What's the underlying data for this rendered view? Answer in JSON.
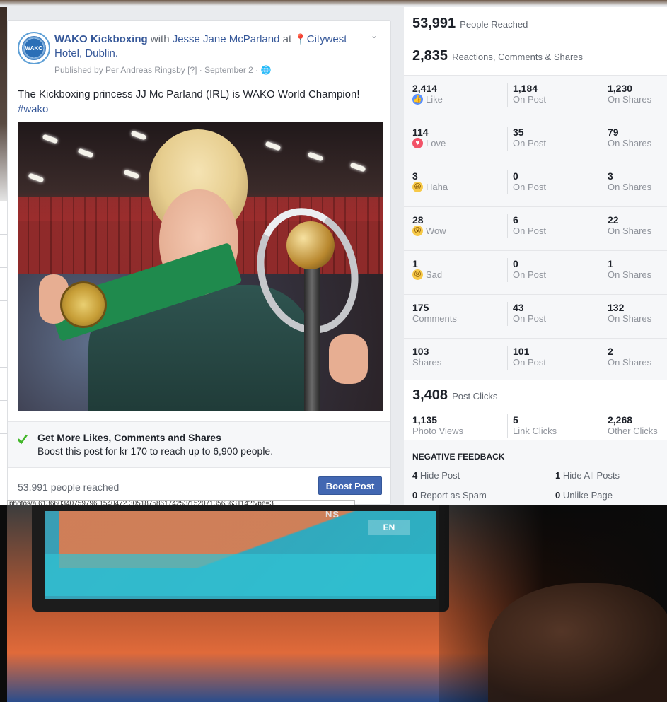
{
  "post": {
    "page_name": "WAKO Kickboxing",
    "with_word": " with ",
    "tagged_person": "Jesse Jane McParland",
    "at_word": " at ",
    "location": "Citywest Hotel, Dublin.",
    "published_by": "Published by Per Andreas Ringsby [?] · September 2 · ",
    "avatar_text": "WAKO",
    "body_text": "The Kickboxing princess JJ Mc Parland (IRL) is WAKO World Champion!",
    "hashtag": "#wako",
    "boost_title": "Get More Likes, Comments and Shares",
    "boost_subtitle": "Boost this post for kr 170 to reach up to 6,900 people.",
    "people_reached_line": "53,991 people reached",
    "boost_button": "Boost Post",
    "tooltip_url": "photos/a.613660340759796.1540472.305187586174253/152071356363114?type=3"
  },
  "stats": {
    "reached_num": "53,991",
    "reached_label": "People Reached",
    "rcs_num": "2,835",
    "rcs_label": "Reactions, Comments & Shares",
    "rows": [
      {
        "total": "2,414",
        "label": "Like",
        "icon": "like-icon",
        "on_post": "1,184",
        "on_shares": "1,230"
      },
      {
        "total": "114",
        "label": "Love",
        "icon": "love-icon",
        "on_post": "35",
        "on_shares": "79"
      },
      {
        "total": "3",
        "label": "Haha",
        "icon": "haha-icon",
        "on_post": "0",
        "on_shares": "3"
      },
      {
        "total": "28",
        "label": "Wow",
        "icon": "wow-icon",
        "on_post": "6",
        "on_shares": "22"
      },
      {
        "total": "1",
        "label": "Sad",
        "icon": "sad-icon",
        "on_post": "0",
        "on_shares": "1"
      },
      {
        "total": "175",
        "label": "Comments",
        "icon": "",
        "on_post": "43",
        "on_shares": "132"
      },
      {
        "total": "103",
        "label": "Shares",
        "icon": "",
        "on_post": "101",
        "on_shares": "2"
      }
    ],
    "on_post_label": "On Post",
    "on_shares_label": "On Shares",
    "clicks_num": "3,408",
    "clicks_label": "Post Clicks",
    "photo_views_num": "1,135",
    "photo_views_label": "Photo Views",
    "link_clicks_num": "5",
    "link_clicks_label": "Link Clicks",
    "other_clicks_num": "2,268",
    "other_clicks_label": "Other Clicks",
    "neg_title": "NEGATIVE FEEDBACK",
    "hide_post_num": "4",
    "hide_post_label": "Hide Post",
    "hide_all_num": "1",
    "hide_all_label": "Hide All Posts",
    "spam_num": "0",
    "spam_label": "Report as Spam",
    "unlike_num": "0",
    "unlike_label": "Unlike Page"
  },
  "screen_photo": {
    "ns_text": "NS",
    "en_text": "EN"
  },
  "colors": {
    "fb_blue": "#4267b2",
    "link_blue": "#365899",
    "like_blue": "#5890ff",
    "love_red": "#f25268",
    "emoji_yellow": "#f7c948"
  }
}
